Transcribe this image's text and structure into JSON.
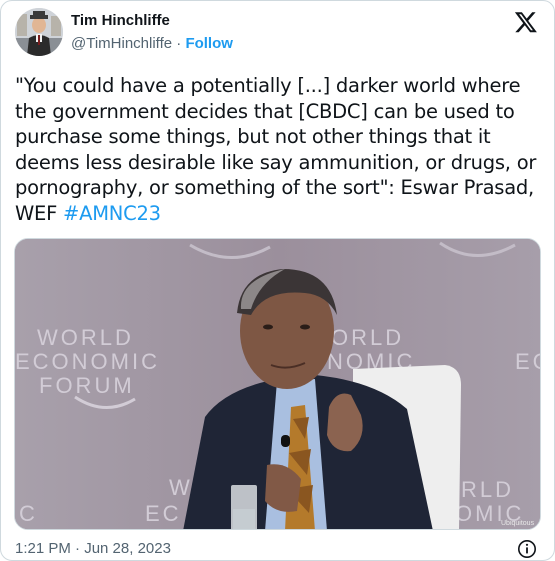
{
  "author": {
    "name": "Tim Hinchliffe",
    "handle": "@TimHinchliffe",
    "separator": "·",
    "follow_label": "Follow"
  },
  "header_icons": {
    "logo": "x-logo-icon"
  },
  "tweet": {
    "text": "\"You could have a potentially [...] darker world where the government decides that [CBDC] can be used to purchase some things, but not other things that it deems less desirable like say ammunition, or drugs, or pornography, or something of the sort\": Eswar Prasad, WEF ",
    "hashtag": "#AMNC23"
  },
  "media": {
    "backdrop_logo_lines": [
      "WORLD",
      "ECONOMIC",
      "FORUM"
    ],
    "backdrop_partial_right_1": "ORLD",
    "backdrop_partial_right_2": "NOMIC",
    "backdrop_partial_edge": "EC",
    "backdrop_bottom_right_1": "RLD",
    "backdrop_bottom_right_2": "OMIC",
    "backdrop_bottom_left_1": "W",
    "backdrop_bottom_left_2": "EC",
    "backdrop_bottom_edge": "C",
    "watermark": "Ubiquitous"
  },
  "footer": {
    "timestamp": "1:21 PM · Jun 28, 2023",
    "info_icon": "info-icon"
  },
  "colors": {
    "link": "#1d9bf0",
    "text": "#0f1419",
    "secondary": "#536471",
    "border": "#cfd9de"
  }
}
